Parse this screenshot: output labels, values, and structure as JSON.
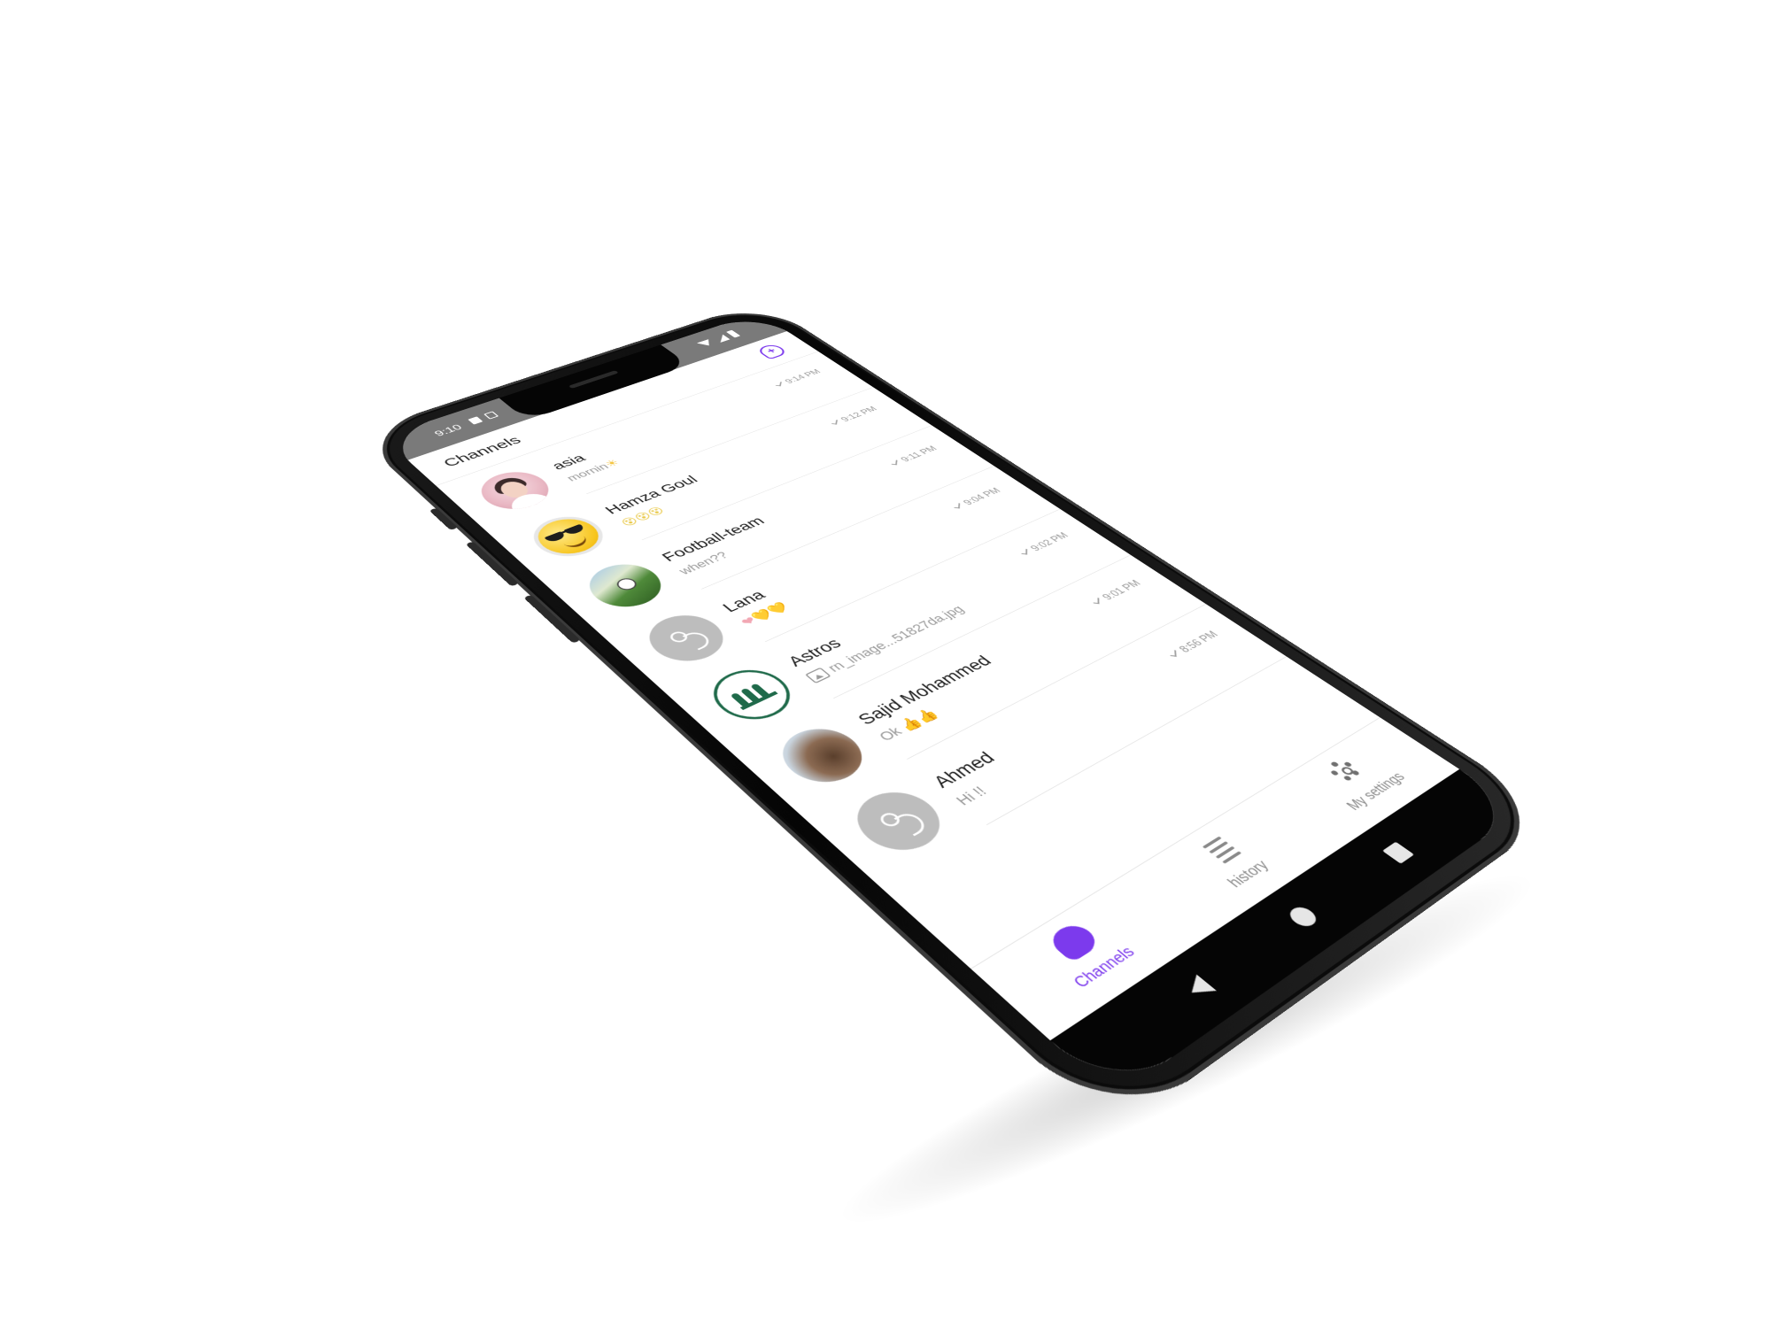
{
  "status_bar": {
    "time": "9:10"
  },
  "header": {
    "title": "Channels",
    "new_chat_icon": "chat-plus-icon"
  },
  "channels": [
    {
      "name": "asia",
      "preview": "mornin",
      "preview_emoji": "☀",
      "time": "9:14 PM",
      "avatar": "profile-photo"
    },
    {
      "name": "Hamza Goul",
      "preview": "",
      "preview_emoji": "😵😵😵",
      "time": "9:12 PM",
      "avatar": "sunglasses-emoji"
    },
    {
      "name": "Football-team",
      "preview": "when??",
      "preview_emoji": "",
      "time": "9:11 PM",
      "avatar": "football-field-photo"
    },
    {
      "name": "Lana",
      "preview": "",
      "preview_emoji": "❤💛💛",
      "time": "9:04 PM",
      "avatar": "placeholder"
    },
    {
      "name": "Astros",
      "preview": "rn_image...51827da.jpg",
      "preview_emoji": "",
      "time": "9:02 PM",
      "avatar": "team-logo"
    },
    {
      "name": "Sajid Mohammed",
      "preview": "Ok",
      "preview_emoji": "👍👍",
      "time": "9:01 PM",
      "avatar": "rock-photo"
    },
    {
      "name": "Ahmed",
      "preview": "Hi !!",
      "preview_emoji": "",
      "time": "8:56 PM",
      "avatar": "placeholder"
    }
  ],
  "bottom_nav": {
    "channels_label": "Channels",
    "history_label": "history",
    "settings_label": "My settings",
    "active": "Channels"
  },
  "colors": {
    "accent": "#7c3aed",
    "status_bar": "#7a7a7a",
    "text": "#1c1c1c",
    "muted": "#9a9a9a"
  }
}
